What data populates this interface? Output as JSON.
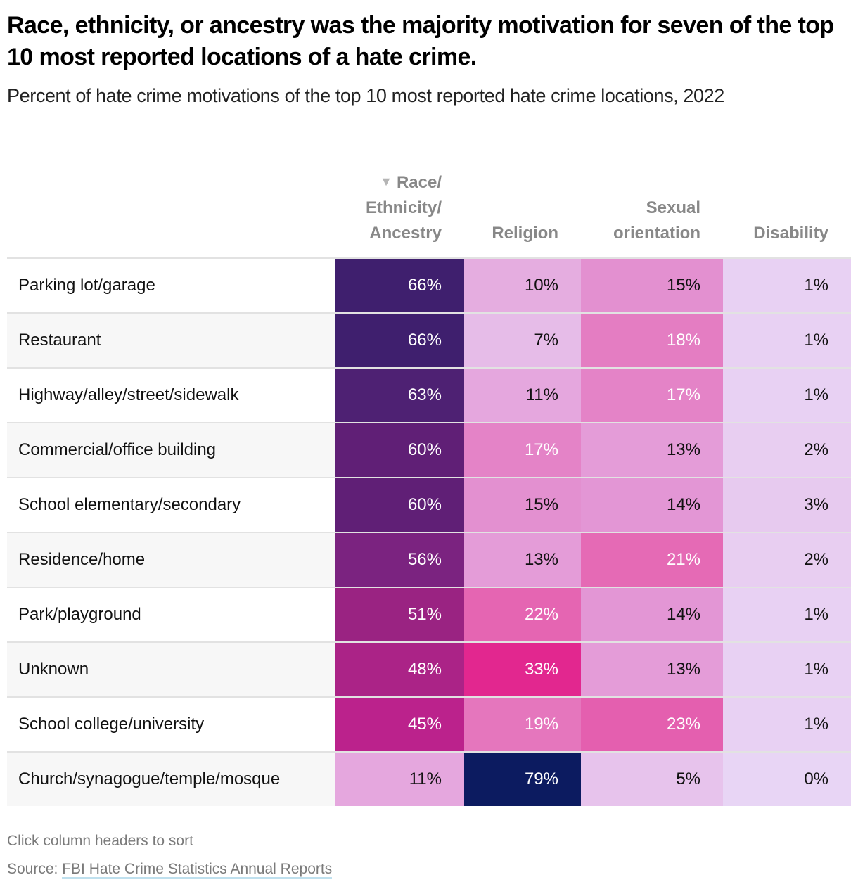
{
  "header": {
    "title": "Race, ethnicity, or ancestry was the majority motivation for seven of the top 10 most reported locations of a hate crime.",
    "subtitle": "Percent of hate crime motivations of the top 10 most reported hate crime locations, 2022"
  },
  "chart_data": {
    "type": "table",
    "title": "Race, ethnicity, or ancestry was the majority motivation for seven of the top 10 most reported locations of a hate crime.",
    "subtitle": "Percent of hate crime motivations of the top 10 most reported hate crime locations, 2022",
    "row_header": "",
    "columns": [
      "Race/ Ethnicity/ Ancestry",
      "Religion",
      "Sexual orientation",
      "Disability"
    ],
    "sorted_column": "Race/ Ethnicity/ Ancestry",
    "sort_direction": "descending",
    "sort_icon": "triangle-down-icon",
    "unit": "%",
    "rows": [
      {
        "location": "Parking lot/garage",
        "values": [
          66,
          10,
          15,
          1
        ]
      },
      {
        "location": "Restaurant",
        "values": [
          66,
          7,
          18,
          1
        ]
      },
      {
        "location": "Highway/alley/street/sidewalk",
        "values": [
          63,
          11,
          17,
          1
        ]
      },
      {
        "location": "Commercial/office building",
        "values": [
          60,
          17,
          13,
          2
        ]
      },
      {
        "location": "School elementary/secondary",
        "values": [
          60,
          15,
          14,
          3
        ]
      },
      {
        "location": "Residence/home",
        "values": [
          56,
          13,
          21,
          2
        ]
      },
      {
        "location": "Park/playground",
        "values": [
          51,
          22,
          14,
          1
        ]
      },
      {
        "location": "Unknown",
        "values": [
          48,
          33,
          13,
          1
        ]
      },
      {
        "location": "School college/university",
        "values": [
          45,
          19,
          23,
          1
        ]
      },
      {
        "location": "Church/synagogue/temple/mosque",
        "values": [
          11,
          79,
          5,
          0
        ]
      }
    ],
    "color_scale": {
      "stops": [
        {
          "value": 0,
          "color": "#e8d5f5"
        },
        {
          "value": 8,
          "color": "#e6b8e6"
        },
        {
          "value": 14,
          "color": "#e396d5"
        },
        {
          "value": 20,
          "color": "#e570b8"
        },
        {
          "value": 33,
          "color": "#e2278f"
        },
        {
          "value": 45,
          "color": "#bb228c"
        },
        {
          "value": 51,
          "color": "#9a2382"
        },
        {
          "value": 56,
          "color": "#7b2380"
        },
        {
          "value": 60,
          "color": "#601f76"
        },
        {
          "value": 63,
          "color": "#4e2173"
        },
        {
          "value": 66,
          "color": "#3f1f6e"
        },
        {
          "value": 79,
          "color": "#0c1b60"
        }
      ],
      "dark_text_threshold": 16
    }
  },
  "footer": {
    "note": "Click column headers to sort",
    "source_prefix": "Source: ",
    "source_link": "FBI Hate Crime Statistics Annual Reports"
  }
}
